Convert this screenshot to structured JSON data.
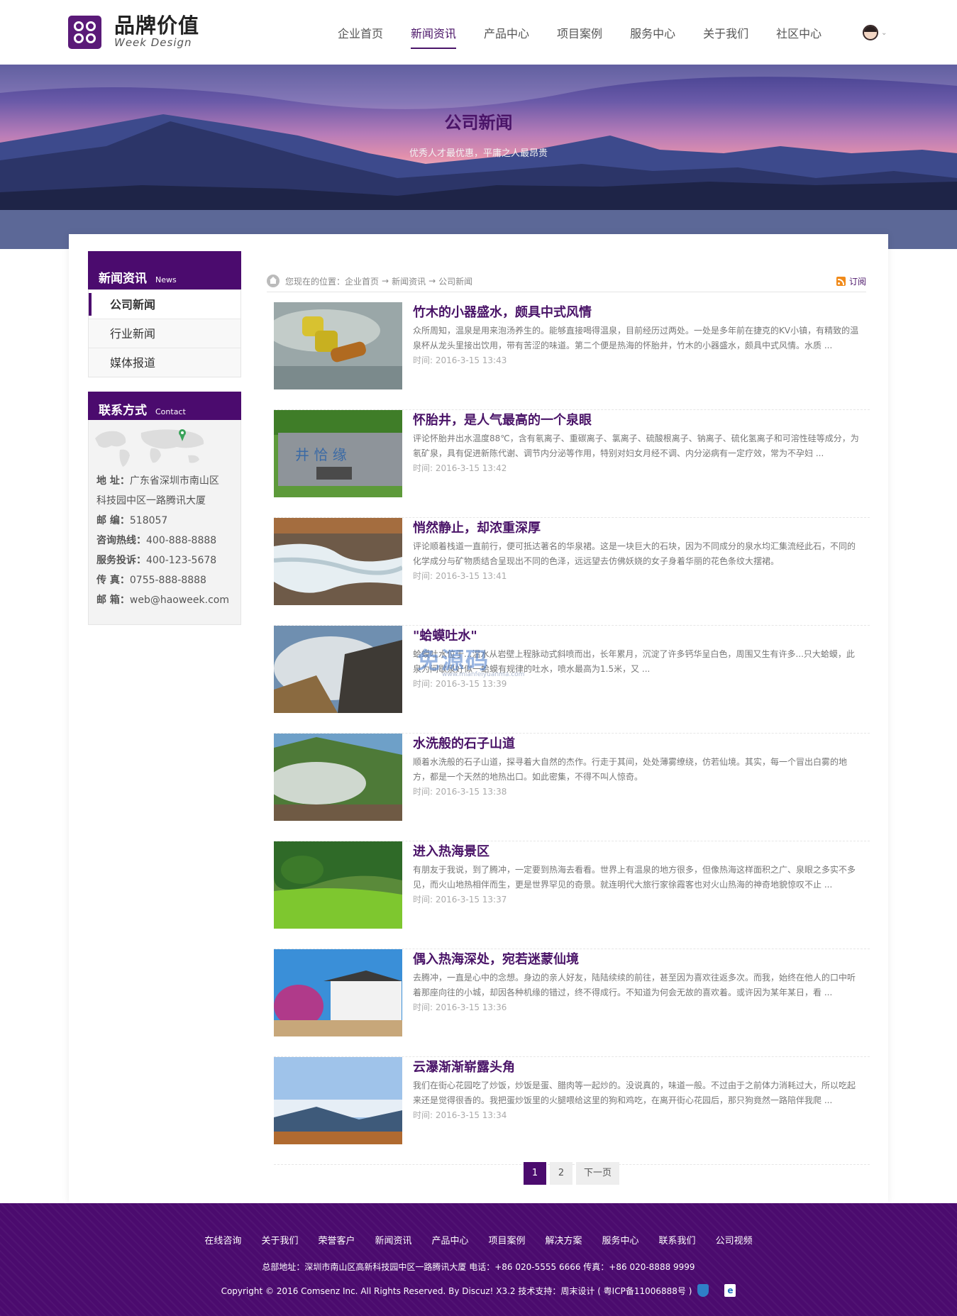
{
  "header": {
    "logo_cn": "品牌价值",
    "logo_en": "Week Design",
    "nav": [
      "企业首页",
      "新闻资讯",
      "产品中心",
      "项目案例",
      "服务中心",
      "关于我们",
      "社区中心"
    ],
    "active_nav": "新闻资讯"
  },
  "banner": {
    "title": "公司新闻",
    "subtitle": "优秀人才最优惠，平庸之人最昂贵"
  },
  "sidebar": {
    "news_title": "新闻资讯",
    "news_title_en": "News",
    "items": [
      {
        "label": "公司新闻",
        "active": true
      },
      {
        "label": "行业新闻",
        "active": false
      },
      {
        "label": "媒体报道",
        "active": false
      }
    ],
    "contact_title": "联系方式",
    "contact_title_en": "Contact",
    "contact": [
      {
        "label": "地 址：",
        "value": "广东省深圳市南山区"
      },
      {
        "label": "",
        "value": "科技园中区一路腾讯大厦"
      },
      {
        "label": "邮 编：",
        "value": "518057"
      },
      {
        "label": "咨询热线：",
        "value": "400-888-8888"
      },
      {
        "label": "服务投诉：",
        "value": "400-123-5678"
      },
      {
        "label": "传 真：",
        "value": "0755-888-8888"
      },
      {
        "label": "邮 箱：",
        "value": "web@haoweek.com"
      }
    ]
  },
  "breadcrumb": {
    "prefix": "您现在的位置：",
    "items": [
      "企业首页",
      "新闻资讯",
      "公司新闻"
    ],
    "rss_label": "订阅"
  },
  "articles": [
    {
      "title": "竹木的小器盛水，颇具中式风情",
      "excerpt": "众所周知，温泉是用来泡汤养生的。能够直接喝得温泉，目前经历过两处。一处是多年前在捷克的KV小镇，有精致的温泉杯从龙头里接出饮用，带有苦涩的味道。第二个便是热海的怀胎井，竹木的小器盛水，颇具中式风情。水质 ...",
      "time": "时间: 2016-3-15 13:43",
      "thumb": "bamboo"
    },
    {
      "title": "怀胎井，是人气最高的一个泉眼",
      "excerpt": "评论怀胎井出水温度88℃，含有氡离子、重碳离子、氯离子、硫酸根离子、钠离子、硫化氢离子和可溶性硅等成分，为氡矿泉，具有促进新陈代谢、调节内分泌等作用，特别对妇女月经不调、内分泌病有一定疗效，常为不孕妇 ...",
      "time": "时间: 2016-3-15 13:42",
      "thumb": "stone"
    },
    {
      "title": "悄然静止，却浓重深厚",
      "excerpt": "评论顺着栈道一直前行，便可抵达著名的华泉裙。这是一块巨大的石块，因为不同成分的泉水均汇集流经此石，不同的化学成分与矿物质结合呈现出不同的色泽，远远望去仿佛妖娆的女子身着华丽的花色条纹大摆裙。",
      "time": "时间: 2016-3-15 13:41",
      "thumb": "stream"
    },
    {
      "title": "\"蛤蟆吐水\"",
      "excerpt": "蛤蟆吐水位于...温水从岩壁上程脉动式斜喷而出，长年累月，沉淀了许多钙华呈白色，周围又生有许多...只大蛤蟆，此泉为间歇泉好似一蛤蟆有规律的吐水，喷水最高为1.5米，又 ...",
      "time": "时间: 2016-3-15 13:39",
      "thumb": "steam"
    },
    {
      "title": "水洗般的石子山道",
      "excerpt": "顺着水洗般的石子山道，探寻着大自然的杰作。行走于其间，处处薄雾缭绕，仿若仙境。其实，每一个冒出白雾的地方，都是一个天然的地热出口。如此密集，不得不叫人惊奇。",
      "time": "时间: 2016-3-15 13:38",
      "thumb": "hill"
    },
    {
      "title": "进入热海景区",
      "excerpt": "有朋友于我说，到了腾冲，一定要到热海去看看。世界上有温泉的地方很多，但像热海这样面积之广、泉眼之多实不多见，而火山地热相伴而生，更是世界罕见的奇景。就连明代大旅行家徐霞客也对火山热海的神奇地貌惊叹不止 ...",
      "time": "时间: 2016-3-15 13:37",
      "thumb": "forest"
    },
    {
      "title": "偶入热海深处，宛若迷蒙仙境",
      "excerpt": "去腾冲，一直是心中的念想。身边的亲人好友，陆陆续续的前往，甚至因为喜欢往返多次。而我，始终在他人的口中听着那座向往的小城，却因各种机缘的错过，终不得成行。不知道为何会无故的喜欢着。或许因为某年某日，看 ...",
      "time": "时间: 2016-3-15 13:36",
      "thumb": "house"
    },
    {
      "title": "云瀑渐渐崭露头角",
      "excerpt": "我们在街心花园吃了炒饭，炒饭是蛋、腊肉等一起炒的。没说真的，味道一般。不过由于之前体力消耗过大，所以吃起来还是觉得很香的。我把蛋炒饭里的火腿喂给这里的狗和鸡吃，在离开街心花园后，那只狗竟然一路陪伴我爬 ...",
      "time": "时间: 2016-3-15 13:34",
      "thumb": "sky"
    }
  ],
  "watermark": {
    "text": "免源码",
    "sub": "www.mianfeiyuanma.com"
  },
  "pagination": {
    "pages": [
      "1",
      "2"
    ],
    "next": "下一页",
    "current": "1"
  },
  "footer": {
    "links": [
      "在线咨询",
      "关于我们",
      "荣誉客户",
      "新闻资讯",
      "产品中心",
      "项目案例",
      "解决方案",
      "服务中心",
      "联系我们",
      "公司视频"
    ],
    "address": "总部地址：深圳市南山区高新科技园中区一路腾讯大厦   电话：+86 020-5555 6666   传真：+86 020-8888 9999",
    "copyright": "Copyright © 2016  Comsenz Inc.  All Rights Reserved. By  Discuz!  X3.2  技术支持：周末设计   ( 粤ICP备11006888号 )"
  },
  "colors": {
    "brand": "#4b0b6e",
    "accent_text": "#4a1468"
  }
}
